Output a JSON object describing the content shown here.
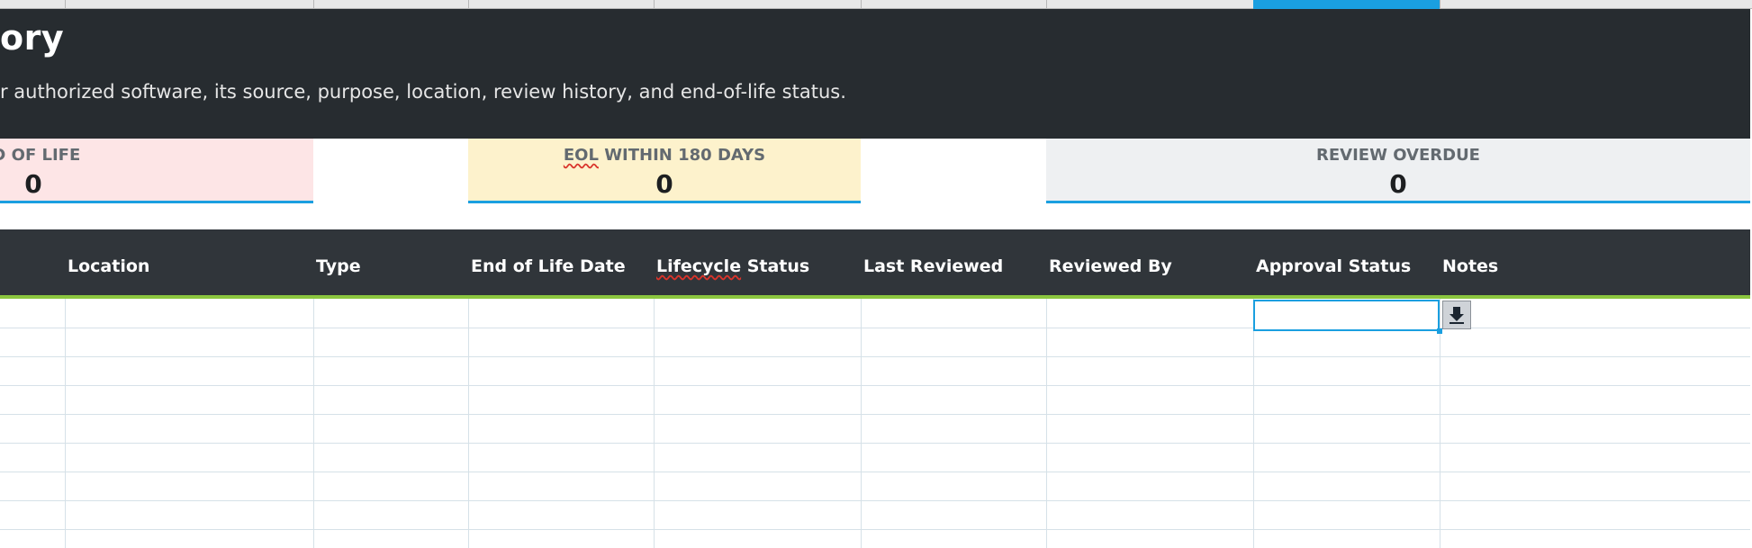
{
  "banner": {
    "title": "ory",
    "subtitle": "r authorized software, its source, purpose, location, review history, and end-of-life status."
  },
  "kpis": [
    {
      "label": "ID OF LIFE",
      "value": "0",
      "color": "#fde5e6"
    },
    {
      "label_prefix": "EOL",
      "label_rest": " WITHIN 180 DAYS",
      "value": "0",
      "color": "#fdf2cc"
    },
    {
      "label": "REVIEW OVERDUE",
      "value": "0",
      "color": "#eef0f2"
    }
  ],
  "table": {
    "columns": [
      "Location",
      "Type",
      "End of Life Date",
      "Lifecycle Status",
      "Last Reviewed",
      "Reviewed By",
      "Approval Status",
      "Notes"
    ],
    "lifecycle_prefix": "Lifecycle",
    "lifecycle_rest": " Status"
  },
  "colors": {
    "banner": "#272c30",
    "header": "#30353a",
    "accent": "#1a9fe0",
    "header_rule": "#8bc63f"
  },
  "icons": {
    "dropdown": "dropdown-arrow-icon"
  }
}
